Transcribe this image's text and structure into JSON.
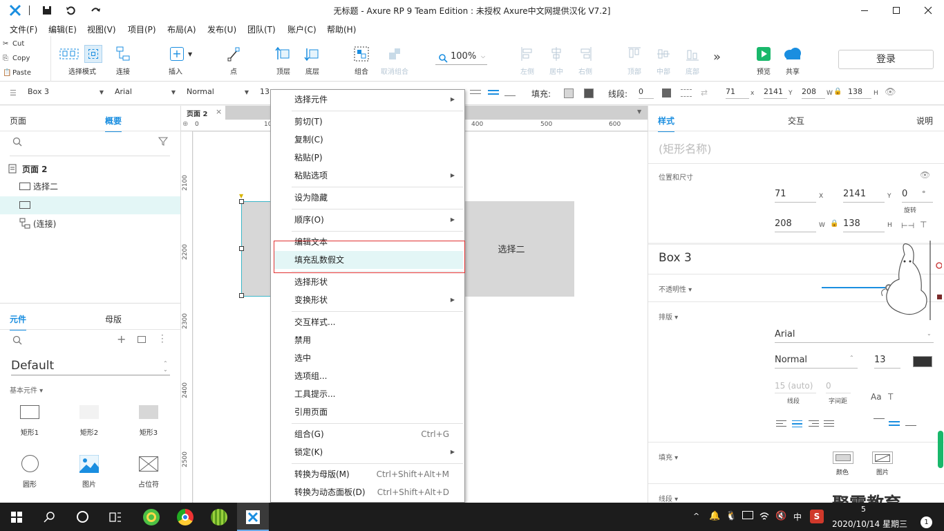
{
  "window": {
    "title": "无标题 - Axure RP 9 Team Edition : 未授权    Axure中文网提供汉化 V7.2]"
  },
  "menu": [
    "文件(F)",
    "编辑(E)",
    "视图(V)",
    "项目(P)",
    "布局(A)",
    "发布(U)",
    "团队(T)",
    "账户(C)",
    "帮助(H)"
  ],
  "clipboard": {
    "cut": "Cut",
    "copy": "Copy",
    "paste": "Paste"
  },
  "toolbar": {
    "select_mode": "选择模式",
    "connect": "连接",
    "insert": "插入",
    "point": "点",
    "top_layer": "顶层",
    "bottom_layer": "底层",
    "group": "组合",
    "ungroup": "取消组合",
    "zoom": "100%",
    "align_left": "左侧",
    "align_center": "居中",
    "align_right": "右侧",
    "align_top": "顶部",
    "align_middle": "中部",
    "align_bottom": "底部",
    "more": "»",
    "preview": "预览",
    "share": "共享",
    "login": "登录"
  },
  "propbar": {
    "widget": "Box 3",
    "font": "Arial",
    "weight": "Normal",
    "size": "13",
    "fill_label": "填充:",
    "stroke_label": "线段:",
    "stroke_value": "0",
    "x": "71",
    "x_unit": "x",
    "y": "2141",
    "y_unit": "Y",
    "w": "208",
    "w_unit": "W",
    "h": "138",
    "h_unit": "H"
  },
  "left": {
    "tab_pages": "页面",
    "tab_outline": "概要",
    "tree": [
      {
        "label": "页面 2"
      },
      {
        "label": "选择二"
      },
      {
        "label": ""
      },
      {
        "label": "(连接)"
      }
    ],
    "tab_widgets": "元件",
    "tab_masters": "母版",
    "library": "Default",
    "category": "基本元件 ▾",
    "widgets": [
      "矩形1",
      "矩形2",
      "矩形3",
      "圆形",
      "图片",
      "占位符"
    ]
  },
  "canvas": {
    "tab": "页面 2",
    "ruler_h": [
      "0",
      "10",
      "400",
      "500",
      "600"
    ],
    "ruler_v": [
      "2100",
      "2200",
      "2300",
      "2400",
      "2500"
    ],
    "shape_text": "选择二"
  },
  "context_menu": [
    {
      "label": "选择元件",
      "sub": true
    },
    {
      "sep": true
    },
    {
      "label": "剪切(T)"
    },
    {
      "label": "复制(C)"
    },
    {
      "label": "粘贴(P)"
    },
    {
      "label": "粘贴选项",
      "sub": true
    },
    {
      "sep": true
    },
    {
      "label": "设为隐藏"
    },
    {
      "sep": true
    },
    {
      "label": "顺序(O)",
      "sub": true
    },
    {
      "sep": true
    },
    {
      "label": "编辑文本"
    },
    {
      "label": "填充乱数假文",
      "highlight": true
    },
    {
      "sep": true
    },
    {
      "label": "选择形状"
    },
    {
      "label": "变换形状",
      "sub": true
    },
    {
      "sep": true
    },
    {
      "label": "交互样式..."
    },
    {
      "label": "禁用"
    },
    {
      "label": "选中"
    },
    {
      "label": "选项组..."
    },
    {
      "label": "工具提示..."
    },
    {
      "label": "引用页面"
    },
    {
      "sep": true
    },
    {
      "label": "组合(G)",
      "shortcut": "Ctrl+G"
    },
    {
      "label": "锁定(K)",
      "sub": true
    },
    {
      "sep": true
    },
    {
      "label": "转换为母版(M)",
      "shortcut": "Ctrl+Shift+Alt+M"
    },
    {
      "label": "转换为动态面板(D)",
      "shortcut": "Ctrl+Shift+Alt+D"
    }
  ],
  "right": {
    "tab_style": "样式",
    "tab_interact": "交互",
    "tab_notes": "说明",
    "name_placeholder": "(矩形名称)",
    "pos_size": "位置和尺寸",
    "x": "71",
    "x_unit": "X",
    "y": "2141",
    "y_unit": "Y",
    "rot": "0",
    "rot_unit": "°",
    "rot_label": "旋转",
    "w": "208",
    "w_unit": "W",
    "h": "138",
    "h_unit": "H",
    "style_name": "Box 3",
    "opacity": "不透明性 ▾",
    "typography": "排版 ▾",
    "font": "Arial",
    "weight": "Normal",
    "size": "13",
    "line_spacing": "15 (auto)",
    "char_spacing": "0",
    "line_spacing_label": "线段",
    "char_spacing_label": "字间距",
    "fill": "填充 ▾",
    "fill_color": "颜色",
    "fill_image": "图片",
    "stroke": "线段 ▾"
  },
  "taskbar": {
    "time": "5",
    "date": "2020/10/14 星期三",
    "ime": "中",
    "notif": "1"
  },
  "watermark": "聚需教育",
  "colors": {
    "accent": "#1a8ee0",
    "highlight": "#e6f7f7",
    "shape": "#d7d7d7",
    "red_box": "#e03030"
  }
}
